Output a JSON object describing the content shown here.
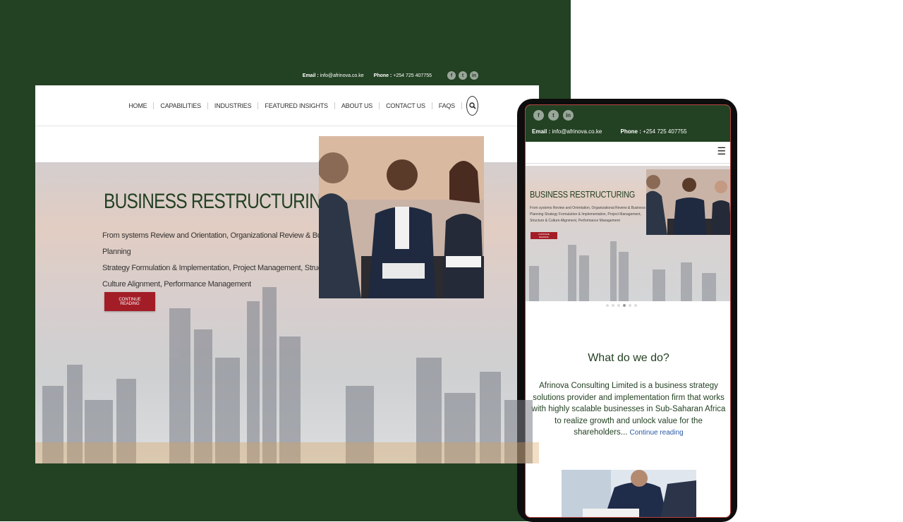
{
  "desktop": {
    "top_bar": {
      "email_label": "Email :",
      "email_value": "info@afrinova.co.ke",
      "phone_label": "Phone :",
      "phone_value": "+254 725 407755",
      "social": [
        "facebook-icon",
        "twitter-icon",
        "linkedin-icon"
      ]
    },
    "nav": {
      "items": [
        "HOME",
        "CAPABILITIES",
        "INDUSTRIES",
        "FEATURED INSIGHTS",
        "ABOUT US",
        "CONTACT US",
        "FAQS"
      ],
      "search_icon": "search-icon"
    },
    "hero": {
      "title": "BUSINESS RESTRUCTURING",
      "line1": "From systems Review and Orientation, Organizational Review & Business Planning",
      "line2": "Strategy Formulation & Implementation, Project Management, Structure &",
      "line3": "Culture Alignment, Performance Management",
      "cta_label": "CONTINUE READING"
    }
  },
  "mobile": {
    "social": [
      "facebook-icon",
      "twitter-icon",
      "linkedin-icon"
    ],
    "email_label": "Email :",
    "email_value": "info@afrinova.co.ke",
    "phone_label": "Phone :",
    "phone_value": "+254 725 407755",
    "menu_icon": "hamburger-menu-icon",
    "hero": {
      "title": "BUSINESS RESTRUCTURING",
      "text": "From systems Review and Orientation, Organizational Review & Business Planning Strategy Formulation & Implementation, Project Management, Structure & Culture Alignment, Performance Management",
      "cta_label": "CONTINUE READING"
    },
    "section_heading": "What do we do?",
    "section_text": "Afrinova Consulting Limited is a business strategy solutions provider and implementation firm that works with highly scalable businesses in Sub-Saharan Africa to realize growth and unlock value for the shareholders...",
    "section_link": "Continue reading"
  },
  "colors": {
    "brand_green": "#234123",
    "accent_red": "#a31d26",
    "link_blue": "#2a5aa6"
  }
}
